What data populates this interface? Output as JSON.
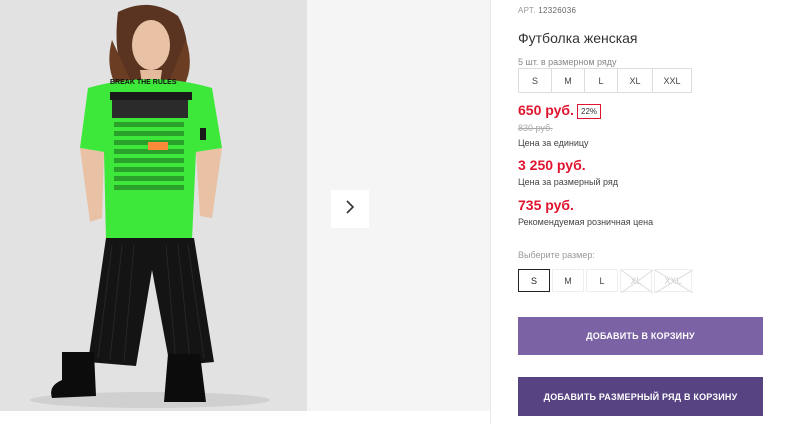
{
  "product": {
    "sku_label": "АРТ.",
    "sku_value": "12326036",
    "title": "Футболка женская",
    "pack_note": "5 шт. в размерном ряду",
    "pack_sizes": [
      "S",
      "M",
      "L",
      "XL",
      "XXL"
    ],
    "shirt_text": "BREAK THE RULES"
  },
  "pricing": {
    "unit_price": "650 руб.",
    "discount": "22%",
    "old_price": "830 руб.",
    "unit_caption": "Цена за единицу",
    "pack_price": "3 250 руб.",
    "pack_caption": "Цена за размерный ряд",
    "retail_price": "735 руб.",
    "retail_caption": "Рекомендуемая розничная цена"
  },
  "size_picker": {
    "label": "Выберите размер:",
    "options": [
      {
        "label": "S",
        "state": "selected"
      },
      {
        "label": "M",
        "state": "available"
      },
      {
        "label": "L",
        "state": "available"
      },
      {
        "label": "XL",
        "state": "unavailable"
      },
      {
        "label": "XXL",
        "state": "unavailable"
      }
    ]
  },
  "actions": {
    "add_to_cart": "ДОБАВИТЬ В КОРЗИНУ",
    "add_pack_to_cart": "ДОБАВИТЬ РАЗМЕРНЫЙ РЯД В КОРЗИНУ"
  },
  "gallery": {
    "next_icon": "chevron-right-icon"
  },
  "colors": {
    "price_red": "#e0142f",
    "button_primary": "#7a62a4",
    "button_secondary": "#574282",
    "shirt_green": "#3ee83a"
  }
}
